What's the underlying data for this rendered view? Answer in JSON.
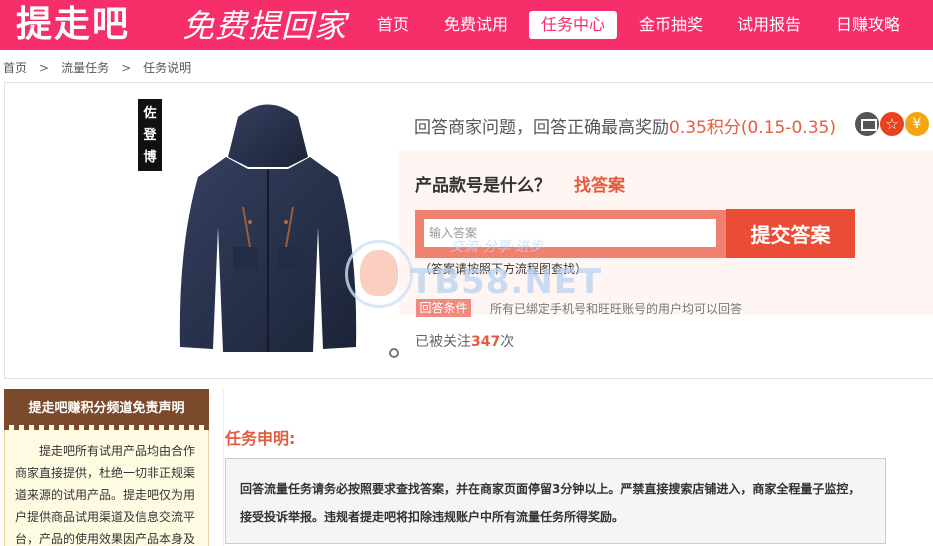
{
  "header": {
    "logo_text": "提走吧",
    "slogan": "免费提回家",
    "nav": [
      {
        "label": "首页",
        "active": false
      },
      {
        "label": "免费试用",
        "active": false
      },
      {
        "label": "任务中心",
        "active": true
      },
      {
        "label": "金币抽奖",
        "active": false
      },
      {
        "label": "试用报告",
        "active": false
      },
      {
        "label": "日赚攻略",
        "active": false
      }
    ],
    "colors": {
      "brand": "#f62e6a"
    }
  },
  "breadcrumb": {
    "items": [
      "首页",
      "流量任务",
      "任务说明"
    ],
    "separator": ">"
  },
  "product": {
    "brand_tag": "佐登博",
    "image_icon": "jacket-image",
    "question_title_prefix": "回答商家问题，回答正确最高奖励",
    "reward": "0.35积分(0.15-0.35)",
    "badges": [
      "pc-icon",
      "star-icon",
      "coin-icon"
    ],
    "star_glyph": "☆",
    "coin_glyph": "¥"
  },
  "qa": {
    "question": "产品款号是什么？",
    "find_link": "找答案",
    "answer_placeholder": "输入答案",
    "submit_label": "提交答案",
    "hint": "（答案请按照下方流程图查找）",
    "condition_badge": "回答条件",
    "condition_text": "所有已绑定手机号和旺旺账号的用户均可以回答",
    "follow_prefix": "已被关注",
    "follow_count": "347",
    "follow_suffix": "次"
  },
  "watermark": {
    "text": "TB58.NET",
    "sub": "交流·分享·进步"
  },
  "disclaimer": {
    "title": "提走吧赚积分频道免责声明",
    "body": "提走吧所有试用产品均由合作商家直接提供，杜绝一切非正规渠道来源的试用产品。提走吧仅为用户提供商品试用渠道及信息交流平台，产品的使用效果因产品本身及"
  },
  "task": {
    "title": "任务申明:",
    "text": "回答流量任务请务必按照要求查找答案，并在商家页面停留3分钟以上。严禁直接搜索店铺进入，商家全程量子监控，接受投诉举报。违规者提走吧将扣除违规账户中所有流量任务所得奖励。"
  }
}
